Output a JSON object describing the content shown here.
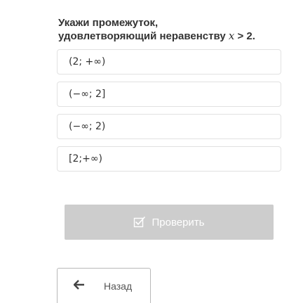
{
  "question": {
    "line1": "Укажи промежуток,",
    "line2_prefix": "удовлетворяющий неравенству ",
    "variable": "x",
    "line2_suffix": " > 2."
  },
  "options": [
    {
      "label": "(2; +∞)"
    },
    {
      "label": "(−∞; 2]"
    },
    {
      "label": "(−∞; 2)"
    },
    {
      "label": "[2;+∞)"
    }
  ],
  "check_button": {
    "label": "Проверить",
    "icon": "checkbox-pencil-icon",
    "state": "disabled"
  },
  "back_button": {
    "label": "Назад",
    "icon": "arrow-left-icon"
  },
  "colors": {
    "text": "#333333",
    "option_border": "#e1e1e1",
    "check_button_bg": "#cdcdcd",
    "back_button_border": "#b8b8b8"
  }
}
